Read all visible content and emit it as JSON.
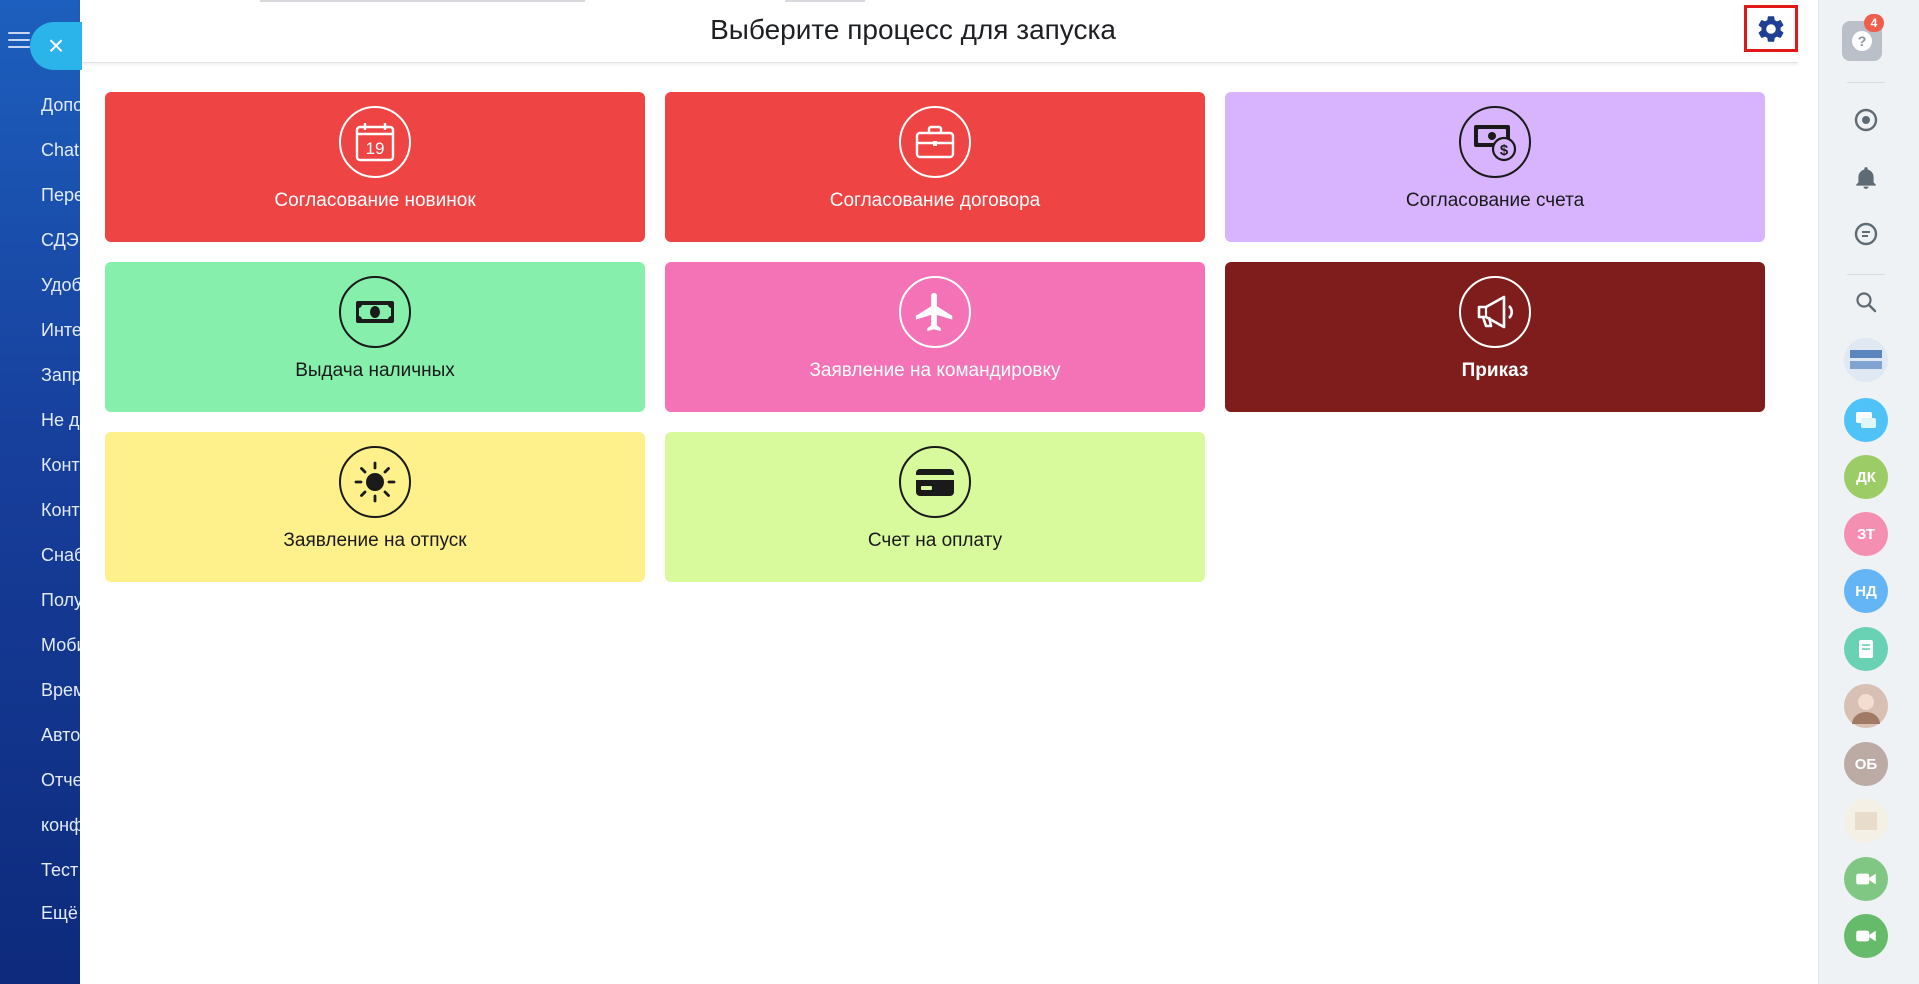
{
  "sidebar": {
    "items": [
      {
        "label": "Допо"
      },
      {
        "label": "Chat"
      },
      {
        "label": "Пере"
      },
      {
        "label": "СДЭ"
      },
      {
        "label": "Удоб"
      },
      {
        "label": "Инте"
      },
      {
        "label": "Запр"
      },
      {
        "label": "Не д"
      },
      {
        "label": "Конт"
      },
      {
        "label": "Конт"
      },
      {
        "label": "Снаб"
      },
      {
        "label": "Полу"
      },
      {
        "label": "Моби"
      },
      {
        "label": "Врем"
      },
      {
        "label": "Авто"
      },
      {
        "label": "Отче"
      },
      {
        "label": "конф"
      },
      {
        "label": "Тест"
      },
      {
        "label": "Ещё"
      }
    ],
    "close_glyph": "×"
  },
  "header": {
    "title": "Выберите процесс для запуска"
  },
  "processes": [
    {
      "label": "Согласование новинок",
      "icon": "calendar-icon",
      "icon_text": "19",
      "bg": "#ef4444",
      "fg": "#ffffff"
    },
    {
      "label": "Согласование договора",
      "icon": "briefcase-icon",
      "bg": "#ef4444",
      "fg": "#ffffff"
    },
    {
      "label": "Согласование счета",
      "icon": "invoice-money-icon",
      "bg": "#d8b4fe",
      "fg": "#1a1a1a"
    },
    {
      "label": "Выдача наличных",
      "icon": "cash-icon",
      "bg": "#86efac",
      "fg": "#1a1a1a"
    },
    {
      "label": "Заявление на командировку",
      "icon": "airplane-icon",
      "bg": "#f472b6",
      "fg": "#ffffff"
    },
    {
      "label": "Приказ",
      "icon": "megaphone-icon",
      "bg": "#7f1d1d",
      "fg": "#ffffff"
    },
    {
      "label": "Заявление на отпуск",
      "icon": "sun-icon",
      "bg": "#fef08a",
      "fg": "#1a1a1a"
    },
    {
      "label": "Счет на оплату",
      "icon": "credit-card-icon",
      "bg": "#d9f99d",
      "fg": "#1a1a1a"
    }
  ],
  "right_bar": {
    "help_badge": "4",
    "avatars": [
      {
        "initials": "ДК",
        "color": "#9ccc65"
      },
      {
        "initials": "ЗТ",
        "color": "#f48fb1"
      },
      {
        "initials": "НД",
        "color": "#64b5f6"
      },
      {
        "initials": "ОБ",
        "color": "#bcaaa4"
      }
    ]
  }
}
